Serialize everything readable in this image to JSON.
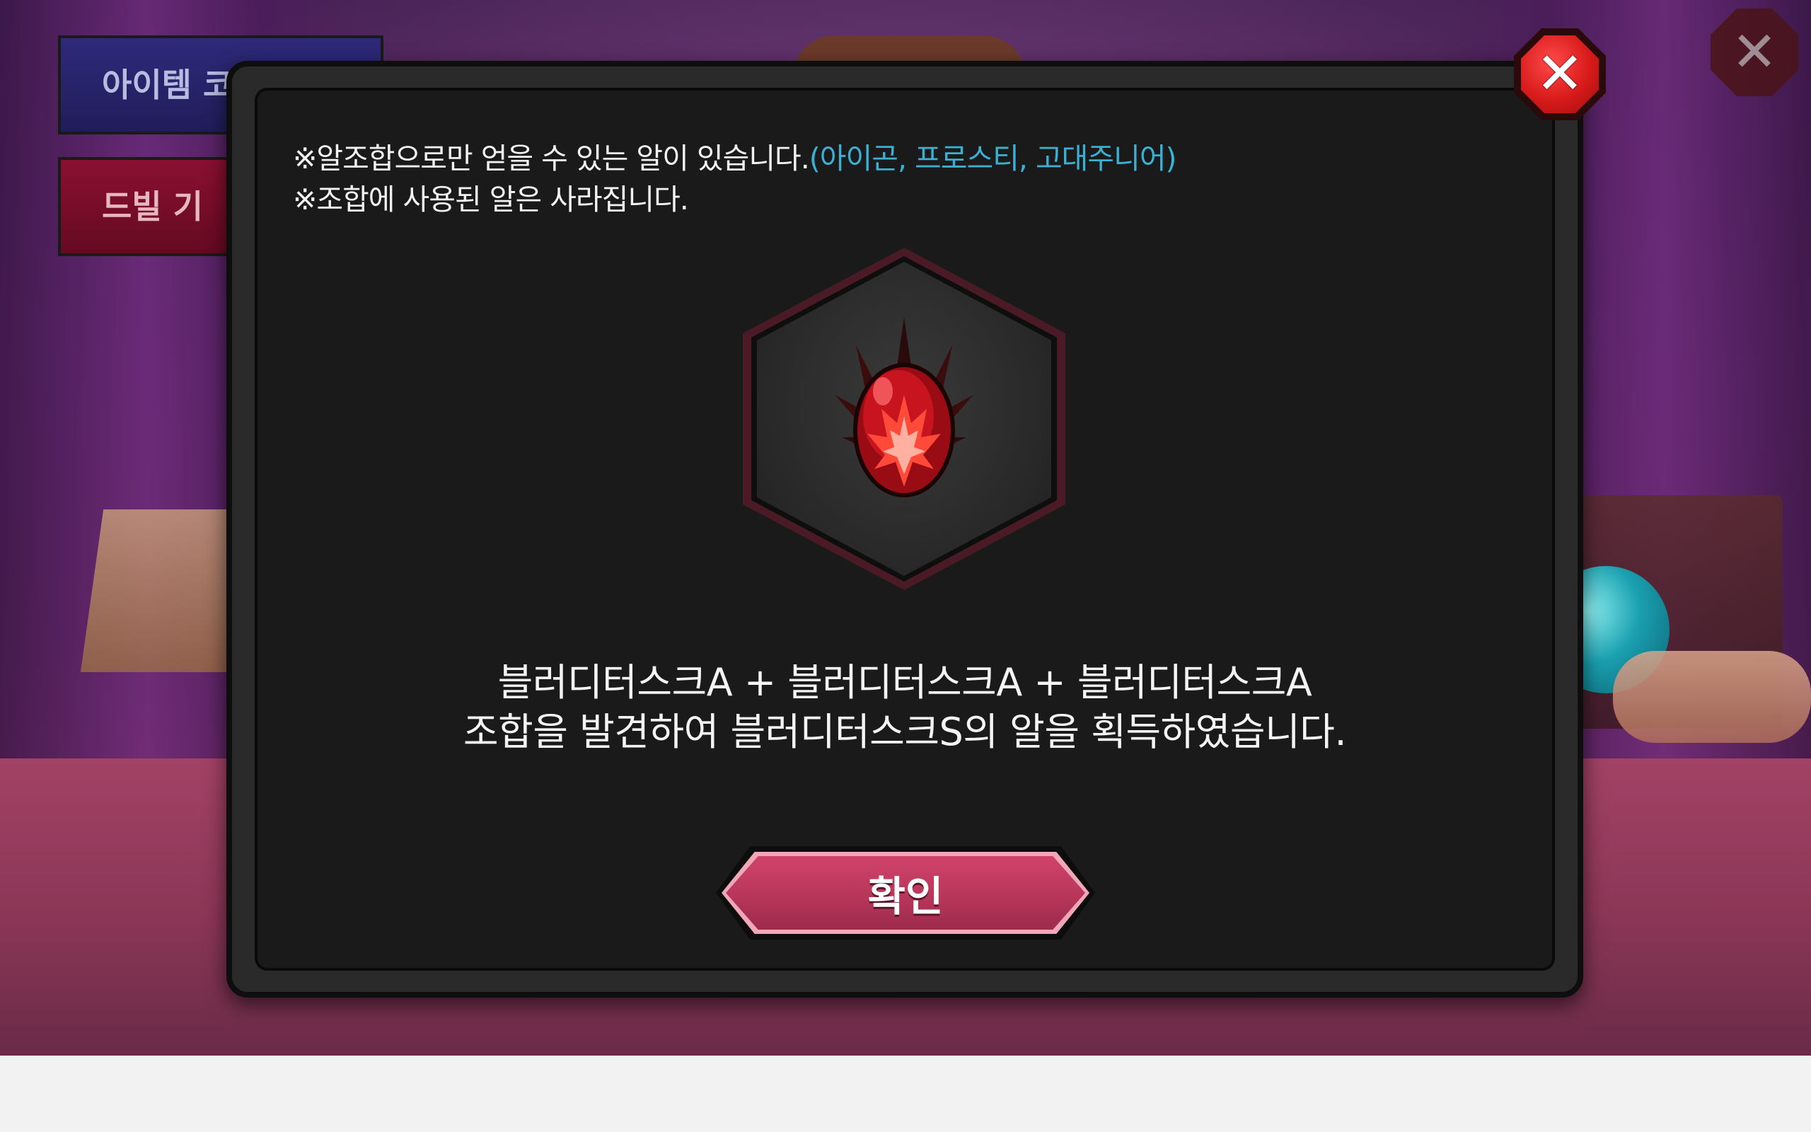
{
  "background": {
    "side_buttons": [
      {
        "label": "아이템 코"
      },
      {
        "label": "드빌 기"
      }
    ]
  },
  "dialog": {
    "notice_1_text": "※알조합으로만 얻을 수 있는 알이 있습니다.",
    "notice_1_highlight": "(아이곤, 프로스티, 고대주니어)",
    "notice_2_text": "※조합에 사용된 알은 사라집니다.",
    "result_line_1": "블러디터스크A + 블러디터스크A + 블러디터스크A",
    "result_line_2": "조합을 발견하여 블러디터스크S의 알을 획득하였습니다.",
    "confirm_label": "확인",
    "egg_icon": "blood-egg-icon"
  },
  "icons": {
    "modal_close": "close-icon",
    "screen_close": "close-icon"
  },
  "colors": {
    "highlight": "#3ab0d4",
    "confirm_button": "#c23d63",
    "close_button": "#d81a1a",
    "egg": "#c8141e"
  }
}
